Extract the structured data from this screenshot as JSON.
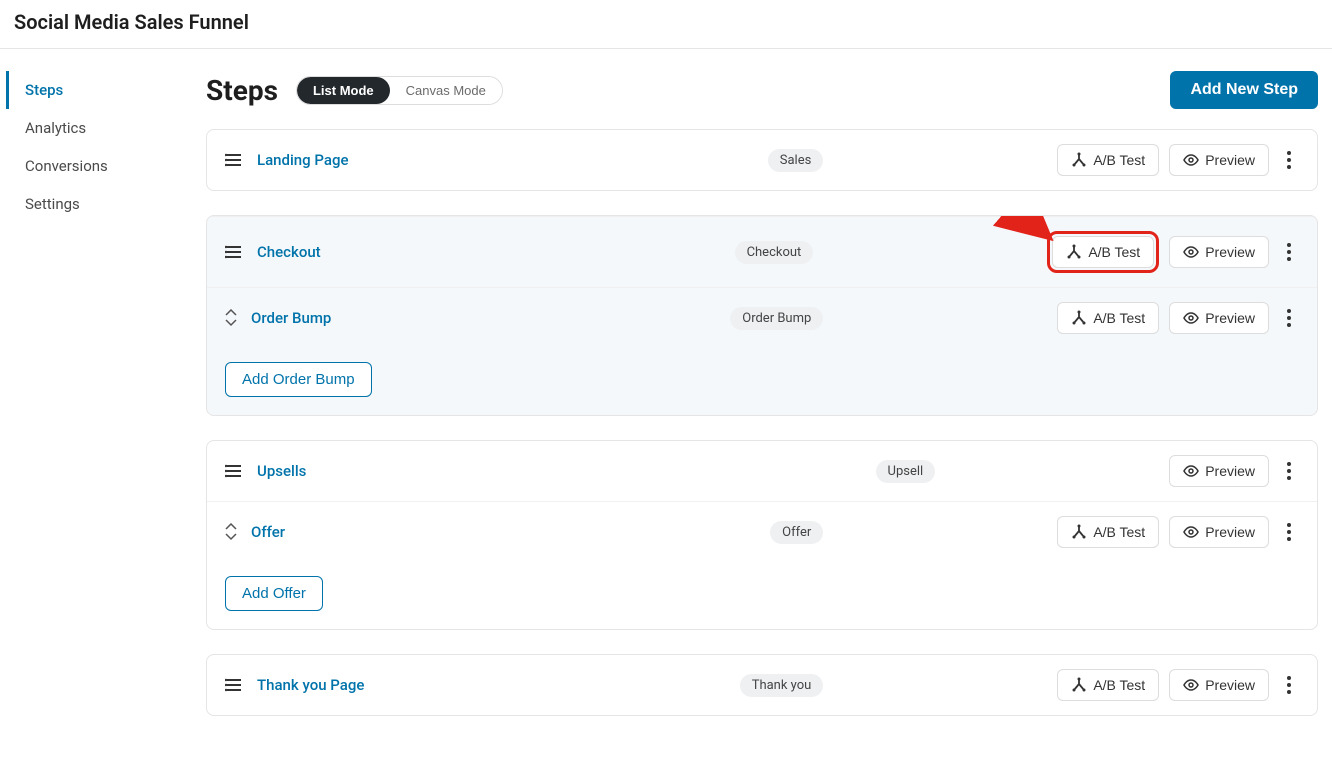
{
  "header": {
    "title": "Social Media Sales Funnel"
  },
  "sidebar": {
    "items": [
      {
        "label": "Steps",
        "active": true
      },
      {
        "label": "Analytics",
        "active": false
      },
      {
        "label": "Conversions",
        "active": false
      },
      {
        "label": "Settings",
        "active": false
      }
    ]
  },
  "page": {
    "title": "Steps",
    "modes": {
      "list": "List Mode",
      "canvas": "Canvas Mode"
    },
    "add_button": "Add New Step"
  },
  "actions": {
    "ab_test": "A/B Test",
    "preview": "Preview",
    "add_order_bump": "Add Order Bump",
    "add_offer": "Add Offer"
  },
  "steps": {
    "landing": {
      "name": "Landing Page",
      "badge": "Sales"
    },
    "checkout": {
      "name": "Checkout",
      "badge": "Checkout"
    },
    "order_bump": {
      "name": "Order Bump",
      "badge": "Order Bump"
    },
    "upsells": {
      "name": "Upsells",
      "badge": "Upsell"
    },
    "offer": {
      "name": "Offer",
      "badge": "Offer"
    },
    "thankyou": {
      "name": "Thank you Page",
      "badge": "Thank you"
    }
  },
  "annotation": {
    "highlight_target": "checkout-ab-test",
    "color": "#e2231a"
  }
}
